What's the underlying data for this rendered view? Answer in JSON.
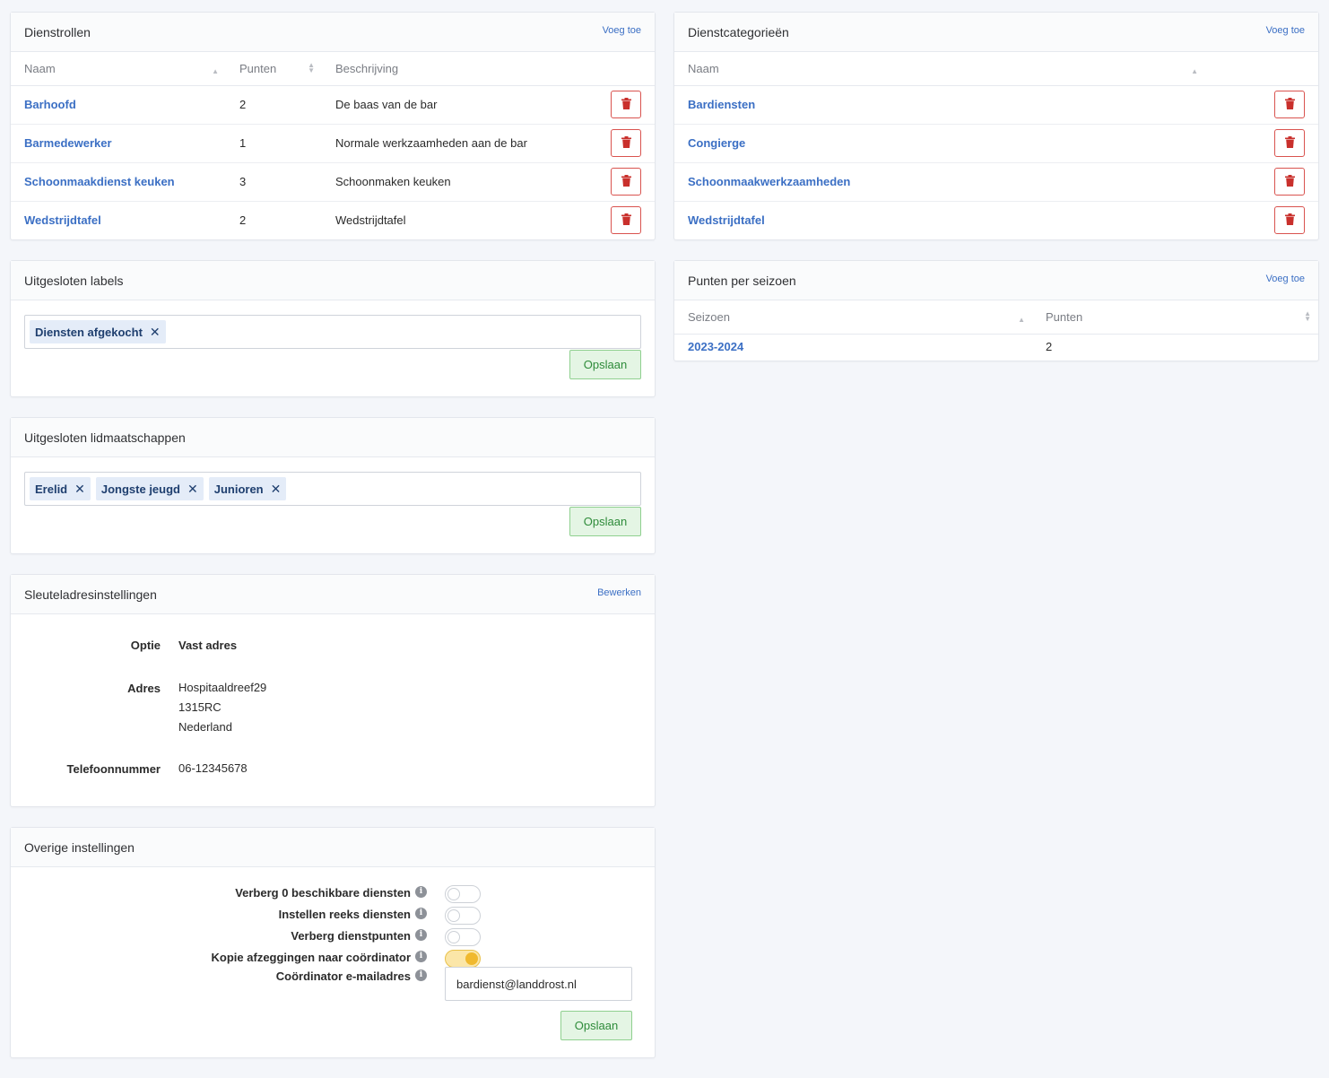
{
  "dienstrollen": {
    "title": "Dienstrollen",
    "add_label": "Voeg toe",
    "columns": [
      "Naam",
      "Punten",
      "Beschrijving"
    ],
    "rows": [
      {
        "naam": "Barhoofd",
        "punten": "2",
        "beschrijving": "De baas van de bar"
      },
      {
        "naam": "Barmedewerker",
        "punten": "1",
        "beschrijving": "Normale werkzaamheden aan de bar"
      },
      {
        "naam": "Schoonmaakdienst keuken",
        "punten": "3",
        "beschrijving": "Schoonmaken keuken"
      },
      {
        "naam": "Wedstrijdtafel",
        "punten": "2",
        "beschrijving": "Wedstrijdtafel"
      }
    ]
  },
  "dienstcategorieen": {
    "title": "Dienstcategorieën",
    "add_label": "Voeg toe",
    "columns": [
      "Naam"
    ],
    "rows": [
      {
        "naam": "Bardiensten"
      },
      {
        "naam": "Congierge"
      },
      {
        "naam": "Schoonmaakwerkzaamheden"
      },
      {
        "naam": "Wedstrijdtafel"
      }
    ]
  },
  "uitgesloten_labels": {
    "title": "Uitgesloten labels",
    "tags": [
      "Diensten afgekocht"
    ],
    "save_label": "Opslaan"
  },
  "punten_per_seizoen": {
    "title": "Punten per seizoen",
    "add_label": "Voeg toe",
    "columns": [
      "Seizoen",
      "Punten"
    ],
    "rows": [
      {
        "seizoen": "2023-2024",
        "punten": "2"
      }
    ]
  },
  "uitgesloten_lidmaatschappen": {
    "title": "Uitgesloten lidmaatschappen",
    "tags": [
      "Erelid",
      "Jongste jeugd",
      "Junioren"
    ],
    "save_label": "Opslaan"
  },
  "sleuteladres": {
    "title": "Sleuteladresinstellingen",
    "edit_label": "Bewerken",
    "optie_label": "Optie",
    "optie_value": "Vast adres",
    "adres_label": "Adres",
    "adres_lines": [
      "Hospitaaldreef29",
      "1315RC",
      "Nederland"
    ],
    "telefoon_label": "Telefoonnummer",
    "telefoon_value": "06-12345678"
  },
  "overige": {
    "title": "Overige instellingen",
    "settings": [
      {
        "label": "Verberg 0 beschikbare diensten",
        "on": false
      },
      {
        "label": "Instellen reeks diensten",
        "on": false
      },
      {
        "label": "Verberg dienstpunten",
        "on": false
      },
      {
        "label": "Kopie afzeggingen naar coördinator",
        "on": true
      }
    ],
    "email_label": "Coördinator e-mailadres",
    "email_value": "bardienst@landdrost.nl",
    "save_label": "Opslaan"
  },
  "colors": {
    "link": "#3b6fc4",
    "danger": "#d9534f",
    "save_bg": "#e4f5e4",
    "toggle_on": "#f0b92f"
  },
  "icons": {
    "delete": "trash-icon",
    "remove_tag": "close-icon",
    "info": "info-icon"
  }
}
